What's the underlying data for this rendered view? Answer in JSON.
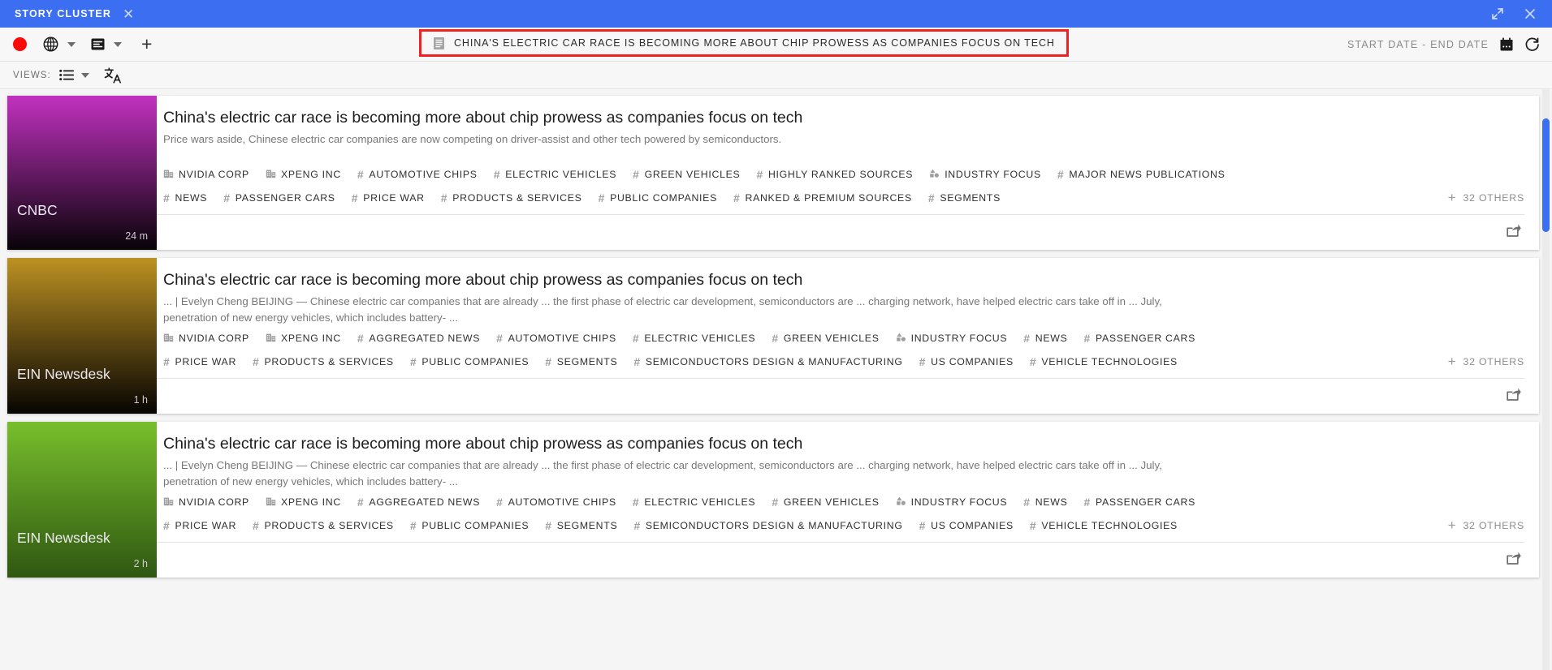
{
  "window": {
    "tab_label": "STORY CLUSTER",
    "close_icon": "close-icon",
    "expand_icon": "expand-icon",
    "window_close_icon": "close-icon",
    "accent_color": "#3b6ef0",
    "highlight_color": "#ee2222"
  },
  "toolbar": {
    "record_dot": "record-dot",
    "globe_icon": "globe-icon",
    "article_icon": "article-icon",
    "add_label": "+",
    "chip": {
      "icon": "document-icon",
      "text": "CHINA'S ELECTRIC CAR RACE IS BECOMING MORE ABOUT CHIP PROWESS AS COMPANIES FOCUS ON TECH"
    },
    "date_range": "START DATE - END DATE",
    "calendar_icon": "calendar-icon",
    "refresh_icon": "refresh-icon"
  },
  "views_bar": {
    "label": "VIEWS:",
    "list_icon": "list-view-icon",
    "translate_icon": "translate-icon"
  },
  "cards": [
    {
      "source": "CNBC",
      "time": "24 m",
      "thumb_from": "#c231c0",
      "thumb_to": "#080308",
      "title": "China's electric car race is becoming more about chip prowess as companies focus on tech",
      "description": "Price wars aside, Chinese electric car companies are now competing on driver-assist and other tech powered by semiconductors.",
      "tag_rows": [
        [
          {
            "icon": "company-icon",
            "label": "NVIDIA CORP"
          },
          {
            "icon": "company-icon",
            "label": "XPENG INC"
          },
          {
            "icon": "hash-icon",
            "label": "AUTOMOTIVE CHIPS"
          },
          {
            "icon": "hash-icon",
            "label": "ELECTRIC VEHICLES"
          },
          {
            "icon": "hash-icon",
            "label": "GREEN VEHICLES"
          },
          {
            "icon": "hash-icon",
            "label": "HIGHLY RANKED SOURCES"
          },
          {
            "icon": "category-icon",
            "label": "INDUSTRY FOCUS"
          },
          {
            "icon": "hash-icon",
            "label": "MAJOR NEWS PUBLICATIONS"
          }
        ],
        [
          {
            "icon": "hash-icon",
            "label": "NEWS"
          },
          {
            "icon": "hash-icon",
            "label": "PASSENGER CARS"
          },
          {
            "icon": "hash-icon",
            "label": "PRICE WAR"
          },
          {
            "icon": "hash-icon",
            "label": "PRODUCTS & SERVICES"
          },
          {
            "icon": "hash-icon",
            "label": "PUBLIC COMPANIES"
          },
          {
            "icon": "hash-icon",
            "label": "RANKED & PREMIUM SOURCES"
          },
          {
            "icon": "hash-icon",
            "label": "SEGMENTS"
          }
        ]
      ],
      "others": "32 OTHERS",
      "share_icon": "share-icon"
    },
    {
      "source": "EIN Newsdesk",
      "time": "1 h",
      "thumb_from": "#bd9122",
      "thumb_to": "#060402",
      "title": "China's electric car race is becoming more about chip prowess as companies focus on tech",
      "description": "... | Evelyn Cheng BEIJING — Chinese electric car companies that are already ... the first phase of electric car development, semiconductors are ... charging network, have helped electric cars take off in ... July, penetration of new energy vehicles, which includes battery- ...",
      "tag_rows": [
        [
          {
            "icon": "company-icon",
            "label": "NVIDIA CORP"
          },
          {
            "icon": "company-icon",
            "label": "XPENG INC"
          },
          {
            "icon": "hash-icon",
            "label": "AGGREGATED NEWS"
          },
          {
            "icon": "hash-icon",
            "label": "AUTOMOTIVE CHIPS"
          },
          {
            "icon": "hash-icon",
            "label": "ELECTRIC VEHICLES"
          },
          {
            "icon": "hash-icon",
            "label": "GREEN VEHICLES"
          },
          {
            "icon": "category-icon",
            "label": "INDUSTRY FOCUS"
          },
          {
            "icon": "hash-icon",
            "label": "NEWS"
          },
          {
            "icon": "hash-icon",
            "label": "PASSENGER CARS"
          }
        ],
        [
          {
            "icon": "hash-icon",
            "label": "PRICE WAR"
          },
          {
            "icon": "hash-icon",
            "label": "PRODUCTS & SERVICES"
          },
          {
            "icon": "hash-icon",
            "label": "PUBLIC COMPANIES"
          },
          {
            "icon": "hash-icon",
            "label": "SEGMENTS"
          },
          {
            "icon": "hash-icon",
            "label": "SEMICONDUCTORS DESIGN & MANUFACTURING"
          },
          {
            "icon": "hash-icon",
            "label": "US COMPANIES"
          },
          {
            "icon": "hash-icon",
            "label": "VEHICLE TECHNOLOGIES"
          }
        ]
      ],
      "others": "32 OTHERS",
      "share_icon": "share-icon"
    },
    {
      "source": "EIN Newsdesk",
      "time": "2 h",
      "thumb_from": "#78bf2c",
      "thumb_to": "#2f5711",
      "title": "China's electric car race is becoming more about chip prowess as companies focus on tech",
      "description": "... | Evelyn Cheng BEIJING — Chinese electric car companies that are already ... the first phase of electric car development, semiconductors are ... charging network, have helped electric cars take off in ... July, penetration of new energy vehicles, which includes battery- ...",
      "tag_rows": [
        [
          {
            "icon": "company-icon",
            "label": "NVIDIA CORP"
          },
          {
            "icon": "company-icon",
            "label": "XPENG INC"
          },
          {
            "icon": "hash-icon",
            "label": "AGGREGATED NEWS"
          },
          {
            "icon": "hash-icon",
            "label": "AUTOMOTIVE CHIPS"
          },
          {
            "icon": "hash-icon",
            "label": "ELECTRIC VEHICLES"
          },
          {
            "icon": "hash-icon",
            "label": "GREEN VEHICLES"
          },
          {
            "icon": "category-icon",
            "label": "INDUSTRY FOCUS"
          },
          {
            "icon": "hash-icon",
            "label": "NEWS"
          },
          {
            "icon": "hash-icon",
            "label": "PASSENGER CARS"
          }
        ],
        [
          {
            "icon": "hash-icon",
            "label": "PRICE WAR"
          },
          {
            "icon": "hash-icon",
            "label": "PRODUCTS & SERVICES"
          },
          {
            "icon": "hash-icon",
            "label": "PUBLIC COMPANIES"
          },
          {
            "icon": "hash-icon",
            "label": "SEGMENTS"
          },
          {
            "icon": "hash-icon",
            "label": "SEMICONDUCTORS DESIGN & MANUFACTURING"
          },
          {
            "icon": "hash-icon",
            "label": "US COMPANIES"
          },
          {
            "icon": "hash-icon",
            "label": "VEHICLE TECHNOLOGIES"
          }
        ]
      ],
      "others": "32 OTHERS",
      "share_icon": "share-icon"
    }
  ]
}
